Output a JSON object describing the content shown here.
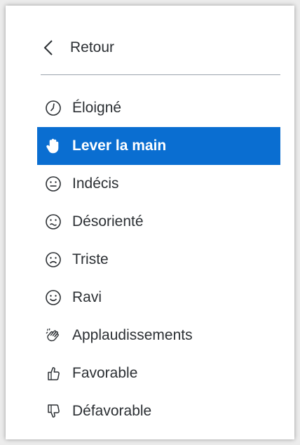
{
  "back": {
    "label": "Retour",
    "icon": "chevron-left-icon"
  },
  "colors": {
    "accent": "#0a6ed1",
    "text": "#2b2f33",
    "divider": "#9aa3ad"
  },
  "status_menu": {
    "selected_index": 1,
    "items": [
      {
        "label": "Éloigné",
        "icon": "clock-icon"
      },
      {
        "label": "Lever la main",
        "icon": "raised-hand-icon"
      },
      {
        "label": "Indécis",
        "icon": "neutral-face-icon"
      },
      {
        "label": "Désorienté",
        "icon": "confused-face-icon"
      },
      {
        "label": "Triste",
        "icon": "sad-face-icon"
      },
      {
        "label": "Ravi",
        "icon": "happy-face-icon"
      },
      {
        "label": "Applaudissements",
        "icon": "clapping-hands-icon"
      },
      {
        "label": "Favorable",
        "icon": "thumbs-up-icon"
      },
      {
        "label": "Défavorable",
        "icon": "thumbs-down-icon"
      }
    ]
  }
}
